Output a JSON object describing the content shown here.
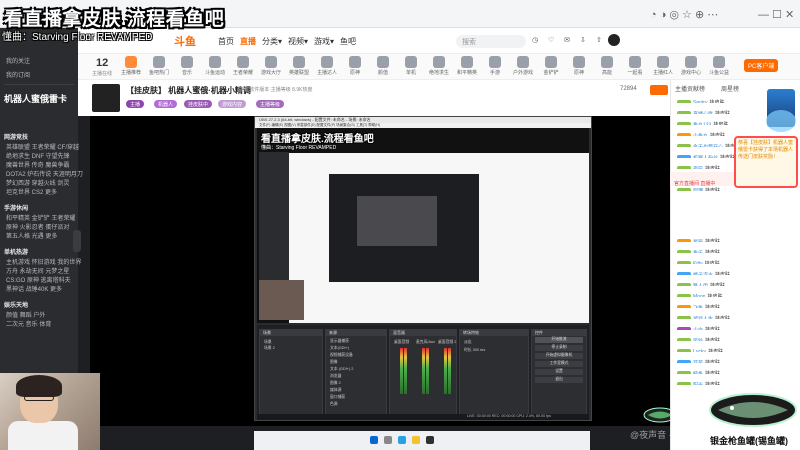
{
  "overlay": {
    "title": "看直播拿皮肤.流程看鱼吧",
    "bgm": "懂曲：Starving Floor REVAMPED"
  },
  "browser": {
    "controls": "— ☐ ✕"
  },
  "header": {
    "logo": "斗鱼",
    "nav": [
      "首页",
      "直播",
      "分类▾",
      "视频▾",
      "游戏▾",
      "鱼吧"
    ],
    "search_placeholder": "搜索"
  },
  "left_sidebar": {
    "top_items": [
      "我的关注",
      "我的订阅"
    ],
    "banner_text": "机器人蜜俄雷卡",
    "sections": [
      {
        "title": "网游竞技",
        "rows": [
          "英雄联盟  王者荣耀  CF/穿越",
          "绝地求生  DNF  守望先锋",
          "魔兽世界  传奇  魔兽争霸",
          "DOTA2  炉石传说  天涯明月刀",
          "梦幻西游  穿越火线  剑灵",
          "坦克世界  CS2  更多"
        ]
      },
      {
        "title": "手游休闲",
        "rows": [
          "和平精英  金铲铲  王者荣耀",
          "原神  火影忍者  蛋仔派对",
          "第五人格  光遇  更多"
        ]
      },
      {
        "title": "单机热游",
        "rows": [
          "主机游戏  怀旧游戏  我的世界",
          "方舟  永劫无间  元梦之星",
          "CS:GO  原神  逃离塔科夫",
          "黑神话  战锤40K  更多"
        ]
      },
      {
        "title": "娱乐天地",
        "rows": [
          "颜值  舞蹈  户外",
          "二次元  音乐  体育"
        ]
      }
    ]
  },
  "category_strip": {
    "count": "12",
    "count_sub": "主播在线",
    "items": [
      "主播推荐",
      "鱼吧热门",
      "音乐",
      "斗鱼运动",
      "王者荣耀",
      "游戏大厅",
      "英雄联盟",
      "主播达人",
      "原神",
      "颜值",
      "单机",
      "绝地求生",
      "和平精英",
      "手游",
      "户外游戏",
      "金铲铲",
      "原神",
      "高能",
      "一起看",
      "主播红人",
      "游戏中心",
      "斗鱼公益"
    ],
    "pc_button": "PC客户端"
  },
  "room": {
    "title": "【挂皮肤】 机器人蜜俄·机器小精调",
    "meta": "直播  软件版本  主播等级  8.9K热度",
    "tags": [
      "主播",
      "机器人",
      "挂皮肤中",
      "游戏内容",
      "主播等级"
    ],
    "right_stat": "72894",
    "right_label": "关注"
  },
  "obs": {
    "window_title": "OBS 27.2.3 (64-bit, windows) - 配置文件: 未命名 - 场景: 未命名",
    "menu": "文件(F)  编辑(E)  视图(V)  停靠部件(D)  配置文件(P)  场景集合(S)  工具(T)  帮助(H)",
    "nested_title": "看直播拿皮肤.流程看鱼吧",
    "nested_bgm": "懂曲：Starving Floor REVAMPED",
    "panels": {
      "scenes": "场景",
      "sources": "来源",
      "mixer": "混音器",
      "transitions": "转场特效",
      "controls": "控件"
    },
    "scene_rows": [
      "场景",
      "场景 2"
    ],
    "source_rows": [
      "显示器捕获",
      "文本(GDI+)",
      "视频捕获设备",
      "图像",
      "文本 (GDI+) 2",
      "浏览器",
      "图像 2",
      "媒体源",
      "窗口捕获",
      "色源"
    ],
    "mixer_rows": [
      "桌面音频",
      "麦克风/Aux",
      "桌面音频 2"
    ],
    "transition_rows": [
      "淡出",
      "时长 300 ms"
    ],
    "control_buttons": [
      "开始推流",
      "停止录制",
      "开始虚拟摄像机",
      "工作室模式",
      "设置",
      "退出"
    ],
    "status": "LIVE: 00:00:00  REC: 00:00:00  CPU: 2.4%, 60.00 fps"
  },
  "chat": {
    "top_tabs": [
      "主播贡献榜",
      "周星榜"
    ],
    "top_button": "贡献榜",
    "highlight": "恭喜【挂皮肤】机器人蜜俄雷卡获得了本场机器人传送门皮肤奖励！",
    "red_note": "官方直播间 直播中",
    "messages": [
      {
        "badge": "g",
        "name": "Sentry",
        "text": "挂皮肤"
      },
      {
        "badge": "g",
        "name": "直播心愿",
        "text": "挂皮肤"
      },
      {
        "badge": "g",
        "name": "鱼丸123",
        "text": "挂皮肤"
      },
      {
        "badge": "o",
        "name": "小鱼丸",
        "text": "挂皮肤"
      },
      {
        "badge": "g",
        "name": "今天也要开心",
        "text": "挂皮肤"
      },
      {
        "badge": "b",
        "name": "机器人粉丝",
        "text": "挂皮肤"
      },
      {
        "badge": "g",
        "name": "夜空",
        "text": "挂皮肤"
      },
      {
        "badge": "p",
        "name": "清风",
        "text": "挂皮肤"
      },
      {
        "badge": "g",
        "name": "阿狸",
        "text": "挂皮肤"
      },
      {
        "badge": "o",
        "name": "星辰",
        "text": "挂皮肤"
      },
      {
        "badge": "g",
        "name": "鱼乐",
        "text": "挂皮肤"
      },
      {
        "badge": "g",
        "name": "Kitty",
        "text": "挂皮肤"
      },
      {
        "badge": "b",
        "name": "橘子汽水",
        "text": "挂皮肤"
      },
      {
        "badge": "g",
        "name": "路人甲",
        "text": "挂皮肤"
      },
      {
        "badge": "g",
        "name": "Moon",
        "text": "挂皮肤"
      },
      {
        "badge": "o",
        "name": "飞鱼",
        "text": "挂皮肤"
      },
      {
        "badge": "g",
        "name": "游戏人生",
        "text": "挂皮肤"
      },
      {
        "badge": "p",
        "name": "小白",
        "text": "挂皮肤"
      },
      {
        "badge": "g",
        "name": "风铃",
        "text": "挂皮肤"
      },
      {
        "badge": "g",
        "name": "Lucky",
        "text": "挂皮肤"
      },
      {
        "badge": "b",
        "name": "草莓",
        "text": "挂皮肤"
      },
      {
        "badge": "g",
        "name": "鲸鱼",
        "text": "挂皮肤"
      },
      {
        "badge": "g",
        "name": "阳光",
        "text": "挂皮肤"
      }
    ]
  },
  "fish": {
    "caption": "银金枪鱼罐(锡鱼罐)"
  },
  "watermark": "@夜声音 · 7..."
}
